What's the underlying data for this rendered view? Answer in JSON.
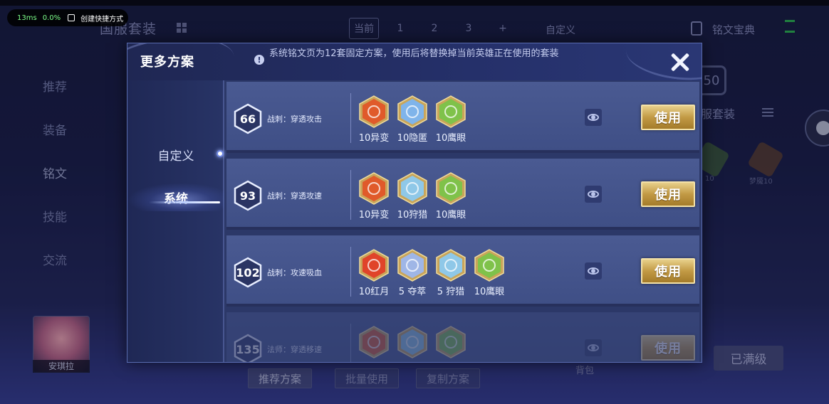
{
  "status_bar": {
    "fps": "13ms",
    "cpu": "0.0%",
    "shortcut": "创建快捷方式"
  },
  "background": {
    "title": "国服套装",
    "tabs": [
      "当前",
      "1",
      "2",
      "3",
      "+"
    ],
    "custom": "自定义",
    "rune_book": "铭文宝典",
    "sidebar": [
      "推荐",
      "装备",
      "铭文",
      "技能",
      "交流"
    ],
    "right_level": "50",
    "right_set": "服套装",
    "right_rune_captions": [
      "10",
      "梦魇10"
    ],
    "hero_name": "安琪拉",
    "bottom_buttons": [
      "推荐方案",
      "批量使用",
      "复制方案"
    ],
    "backpack": "背包",
    "maxed": "已满级"
  },
  "modal": {
    "title": "更多方案",
    "notice": "系统铭文页为12套固定方案，使用后将替换掉当前英雄正在使用的套装",
    "tabs": [
      {
        "label": "自定义",
        "active": false
      },
      {
        "label": "系统",
        "active": true
      }
    ],
    "use_label": "使用",
    "schemes": [
      {
        "level": "66",
        "name": "战刺：穿透攻击",
        "runes": [
          {
            "caption": "10异变",
            "color": "#e05a2a",
            "icon": "flame-ring-icon"
          },
          {
            "caption": "10隐匿",
            "color": "#7fb4ea",
            "icon": "water-drop-icon"
          },
          {
            "caption": "10鹰眼",
            "color": "#7fc24a",
            "icon": "clover-icon"
          }
        ]
      },
      {
        "level": "93",
        "name": "战刺：穿透攻速",
        "runes": [
          {
            "caption": "10异变",
            "color": "#e05a2a",
            "icon": "flame-ring-icon"
          },
          {
            "caption": "10狩猎",
            "color": "#8fc8e8",
            "icon": "arrows-icon"
          },
          {
            "caption": "10鹰眼",
            "color": "#7fc24a",
            "icon": "clover-icon"
          }
        ]
      },
      {
        "level": "102",
        "name": "战刺：攻速吸血",
        "runes": [
          {
            "caption": "10红月",
            "color": "#e0442a",
            "icon": "red-moon-icon"
          },
          {
            "caption": "5 夺萃",
            "color": "#9fb6e6",
            "icon": "knot-icon"
          },
          {
            "caption": "5 狩猎",
            "color": "#8fc8e8",
            "icon": "arrows-icon"
          },
          {
            "caption": "10鹰眼",
            "color": "#7fc24a",
            "icon": "clover-icon"
          }
        ]
      },
      {
        "level": "135",
        "name": "法师：穿透移速",
        "runes": [
          {
            "caption": "",
            "color": "#e05a2a",
            "icon": "flame-ring-icon"
          },
          {
            "caption": "",
            "color": "#8fc8e8",
            "icon": "arrows-icon"
          },
          {
            "caption": "",
            "color": "#7fc24a",
            "icon": "clover-icon"
          }
        ]
      }
    ]
  }
}
